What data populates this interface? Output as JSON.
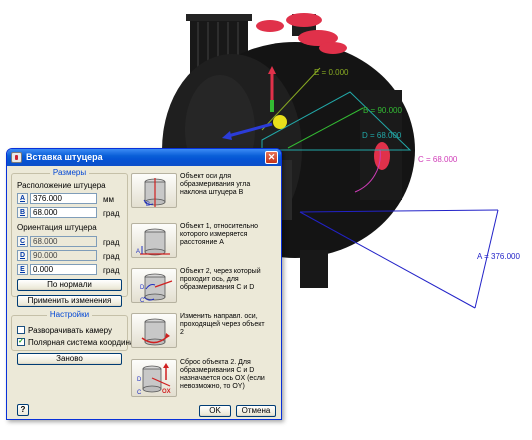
{
  "scene": {
    "dim_a": "A = 376.000",
    "dim_b": "B = 90.000",
    "dim_c": "C = 68.000",
    "dim_d": "D = 68.000",
    "dim_e": "E = 0.000",
    "colors": {
      "dim_a": "#2222c8",
      "dim_b": "#33bb33",
      "dim_c": "#d03cb8",
      "dim_d": "#22a8a8",
      "dim_e": "#88aa22",
      "red_caps": "#e0314a",
      "vessel": "#141414"
    }
  },
  "dialog": {
    "title": "Вставка штуцера",
    "close_icon": "close-icon",
    "sizes": {
      "title": "Размеры",
      "location_label": "Расположение штуцера",
      "a": {
        "icon_letter": "A",
        "value": "376.000",
        "unit": "мм"
      },
      "b": {
        "icon_letter": "B",
        "value": "68.000",
        "unit": "град"
      }
    },
    "orientation": {
      "label": "Ориентация штуцера",
      "c": {
        "icon_letter": "C",
        "value": "68.000",
        "unit": "град"
      },
      "d": {
        "icon_letter": "D",
        "value": "90.000",
        "unit": "град"
      },
      "e": {
        "icon_letter": "E",
        "value": "0.000",
        "unit": "град"
      }
    },
    "buttons": {
      "normal": "По нормали",
      "apply": "Применить изменения",
      "again": "Заново",
      "ok": "OK",
      "cancel": "Отмена",
      "help": "?"
    },
    "settings": {
      "title": "Настройки",
      "rotate_camera": {
        "label": "Разворачивать камеру",
        "checked": false
      },
      "polar": {
        "label": "Полярная система координат",
        "checked": true
      }
    },
    "icon_items": [
      {
        "label_a": "",
        "label_b": "B",
        "text": "Объект оси для образмеривания угла наклона штуцера B"
      },
      {
        "label_a": "A",
        "label_b": "",
        "text": "Объект 1, относительно которого измеряется расстояние A"
      },
      {
        "label_a": "D",
        "label_b": "C",
        "text": "Объект 2, через который проходит ось, для образмеривания C и D"
      },
      {
        "label_a": "",
        "label_b": "",
        "text": "Изменить направл. оси, проходящей через объект 2"
      },
      {
        "label_a": "D",
        "label_b": "C",
        "label_c": "OX",
        "text": "Сброс объекта 2. Для образмеривания C и D назначается ось OX (если невозможно, то OY)"
      }
    ]
  }
}
